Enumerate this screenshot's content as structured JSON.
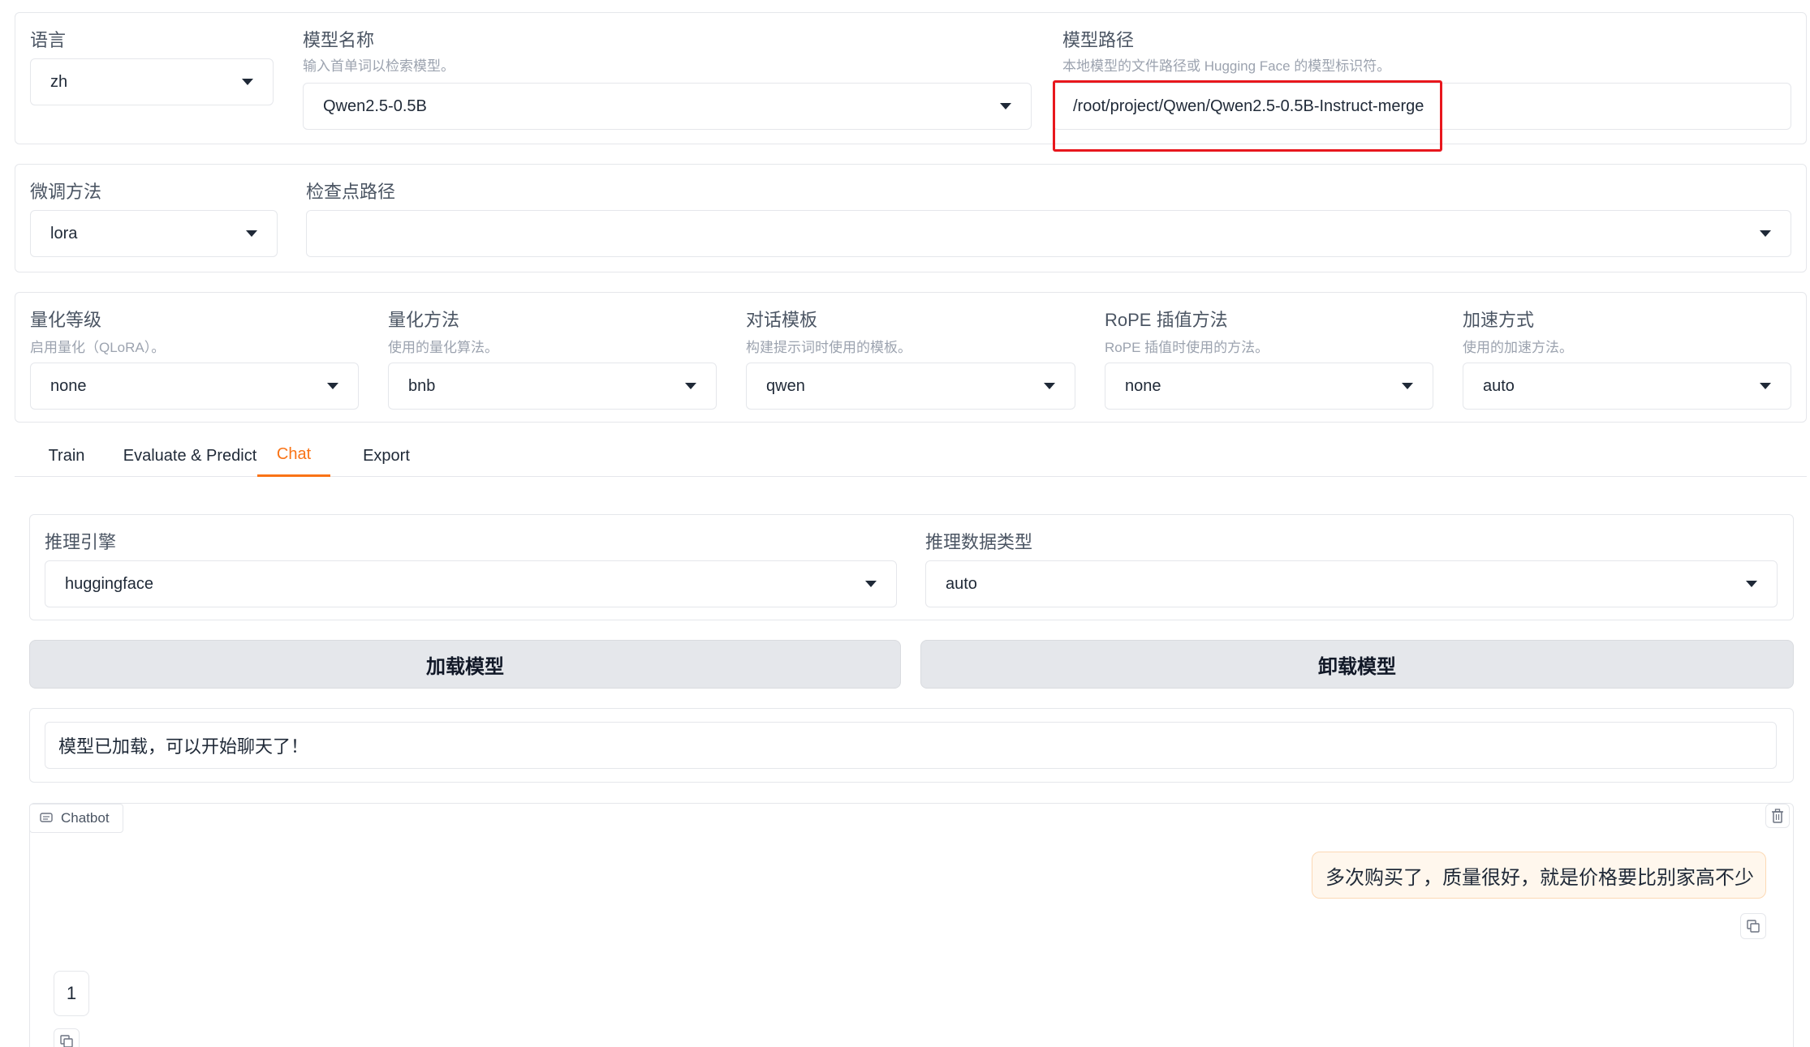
{
  "top": {
    "lang": {
      "label": "语言",
      "value": "zh"
    },
    "model_name": {
      "label": "模型名称",
      "info": "输入首单词以检索模型。",
      "value": "Qwen2.5-0.5B"
    },
    "model_path": {
      "label": "模型路径",
      "info": "本地模型的文件路径或 Hugging Face 的模型标识符。",
      "value": "/root/project/Qwen/Qwen2.5-0.5B-Instruct-merge"
    }
  },
  "finetune": {
    "method": {
      "label": "微调方法",
      "value": "lora"
    },
    "checkpoint": {
      "label": "检查点路径",
      "value": ""
    }
  },
  "advanced": {
    "quant_bit": {
      "label": "量化等级",
      "info": "启用量化（QLoRA）。",
      "value": "none"
    },
    "quant_method": {
      "label": "量化方法",
      "info": "使用的量化算法。",
      "value": "bnb"
    },
    "template": {
      "label": "对话模板",
      "info": "构建提示词时使用的模板。",
      "value": "qwen"
    },
    "rope": {
      "label": "RoPE 插值方法",
      "info": "RoPE 插值时使用的方法。",
      "value": "none"
    },
    "booster": {
      "label": "加速方式",
      "info": "使用的加速方法。",
      "value": "auto"
    }
  },
  "tabs": [
    {
      "label": "Train"
    },
    {
      "label": "Evaluate & Predict"
    },
    {
      "label": "Chat"
    },
    {
      "label": "Export"
    }
  ],
  "active_tab": "Chat",
  "chat": {
    "infer_backend": {
      "label": "推理引擎",
      "value": "huggingface"
    },
    "infer_dtype": {
      "label": "推理数据类型",
      "value": "auto"
    },
    "load_button": "加载模型",
    "unload_button": "卸载模型",
    "info_box": "模型已加载，可以开始聊天了！",
    "chatbot_label": "Chatbot",
    "messages": [
      {
        "role": "user",
        "text": "多次购买了，质量很好，就是价格要比别家高不少"
      },
      {
        "role": "assistant",
        "text": "1"
      }
    ]
  },
  "colors": {
    "accent": "#f97316",
    "highlight_box": "#e8171d",
    "user_bubble": "#fff7ed",
    "button_bg": "#e5e7eb"
  },
  "icons": [
    "chevron-down-icon",
    "chat-icon",
    "trash-icon",
    "copy-icon"
  ]
}
